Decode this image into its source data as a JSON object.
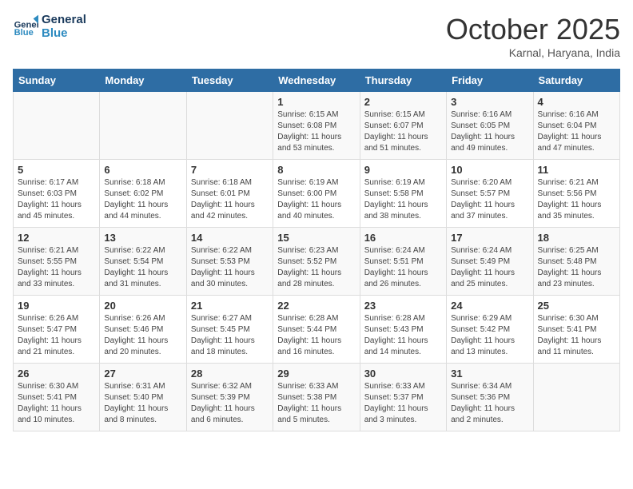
{
  "header": {
    "logo_line1": "General",
    "logo_line2": "Blue",
    "month": "October 2025",
    "location": "Karnal, Haryana, India"
  },
  "days_of_week": [
    "Sunday",
    "Monday",
    "Tuesday",
    "Wednesday",
    "Thursday",
    "Friday",
    "Saturday"
  ],
  "weeks": [
    [
      {
        "day": "",
        "info": ""
      },
      {
        "day": "",
        "info": ""
      },
      {
        "day": "",
        "info": ""
      },
      {
        "day": "1",
        "info": "Sunrise: 6:15 AM\nSunset: 6:08 PM\nDaylight: 11 hours\nand 53 minutes."
      },
      {
        "day": "2",
        "info": "Sunrise: 6:15 AM\nSunset: 6:07 PM\nDaylight: 11 hours\nand 51 minutes."
      },
      {
        "day": "3",
        "info": "Sunrise: 6:16 AM\nSunset: 6:05 PM\nDaylight: 11 hours\nand 49 minutes."
      },
      {
        "day": "4",
        "info": "Sunrise: 6:16 AM\nSunset: 6:04 PM\nDaylight: 11 hours\nand 47 minutes."
      }
    ],
    [
      {
        "day": "5",
        "info": "Sunrise: 6:17 AM\nSunset: 6:03 PM\nDaylight: 11 hours\nand 45 minutes."
      },
      {
        "day": "6",
        "info": "Sunrise: 6:18 AM\nSunset: 6:02 PM\nDaylight: 11 hours\nand 44 minutes."
      },
      {
        "day": "7",
        "info": "Sunrise: 6:18 AM\nSunset: 6:01 PM\nDaylight: 11 hours\nand 42 minutes."
      },
      {
        "day": "8",
        "info": "Sunrise: 6:19 AM\nSunset: 6:00 PM\nDaylight: 11 hours\nand 40 minutes."
      },
      {
        "day": "9",
        "info": "Sunrise: 6:19 AM\nSunset: 5:58 PM\nDaylight: 11 hours\nand 38 minutes."
      },
      {
        "day": "10",
        "info": "Sunrise: 6:20 AM\nSunset: 5:57 PM\nDaylight: 11 hours\nand 37 minutes."
      },
      {
        "day": "11",
        "info": "Sunrise: 6:21 AM\nSunset: 5:56 PM\nDaylight: 11 hours\nand 35 minutes."
      }
    ],
    [
      {
        "day": "12",
        "info": "Sunrise: 6:21 AM\nSunset: 5:55 PM\nDaylight: 11 hours\nand 33 minutes."
      },
      {
        "day": "13",
        "info": "Sunrise: 6:22 AM\nSunset: 5:54 PM\nDaylight: 11 hours\nand 31 minutes."
      },
      {
        "day": "14",
        "info": "Sunrise: 6:22 AM\nSunset: 5:53 PM\nDaylight: 11 hours\nand 30 minutes."
      },
      {
        "day": "15",
        "info": "Sunrise: 6:23 AM\nSunset: 5:52 PM\nDaylight: 11 hours\nand 28 minutes."
      },
      {
        "day": "16",
        "info": "Sunrise: 6:24 AM\nSunset: 5:51 PM\nDaylight: 11 hours\nand 26 minutes."
      },
      {
        "day": "17",
        "info": "Sunrise: 6:24 AM\nSunset: 5:49 PM\nDaylight: 11 hours\nand 25 minutes."
      },
      {
        "day": "18",
        "info": "Sunrise: 6:25 AM\nSunset: 5:48 PM\nDaylight: 11 hours\nand 23 minutes."
      }
    ],
    [
      {
        "day": "19",
        "info": "Sunrise: 6:26 AM\nSunset: 5:47 PM\nDaylight: 11 hours\nand 21 minutes."
      },
      {
        "day": "20",
        "info": "Sunrise: 6:26 AM\nSunset: 5:46 PM\nDaylight: 11 hours\nand 20 minutes."
      },
      {
        "day": "21",
        "info": "Sunrise: 6:27 AM\nSunset: 5:45 PM\nDaylight: 11 hours\nand 18 minutes."
      },
      {
        "day": "22",
        "info": "Sunrise: 6:28 AM\nSunset: 5:44 PM\nDaylight: 11 hours\nand 16 minutes."
      },
      {
        "day": "23",
        "info": "Sunrise: 6:28 AM\nSunset: 5:43 PM\nDaylight: 11 hours\nand 14 minutes."
      },
      {
        "day": "24",
        "info": "Sunrise: 6:29 AM\nSunset: 5:42 PM\nDaylight: 11 hours\nand 13 minutes."
      },
      {
        "day": "25",
        "info": "Sunrise: 6:30 AM\nSunset: 5:41 PM\nDaylight: 11 hours\nand 11 minutes."
      }
    ],
    [
      {
        "day": "26",
        "info": "Sunrise: 6:30 AM\nSunset: 5:41 PM\nDaylight: 11 hours\nand 10 minutes."
      },
      {
        "day": "27",
        "info": "Sunrise: 6:31 AM\nSunset: 5:40 PM\nDaylight: 11 hours\nand 8 minutes."
      },
      {
        "day": "28",
        "info": "Sunrise: 6:32 AM\nSunset: 5:39 PM\nDaylight: 11 hours\nand 6 minutes."
      },
      {
        "day": "29",
        "info": "Sunrise: 6:33 AM\nSunset: 5:38 PM\nDaylight: 11 hours\nand 5 minutes."
      },
      {
        "day": "30",
        "info": "Sunrise: 6:33 AM\nSunset: 5:37 PM\nDaylight: 11 hours\nand 3 minutes."
      },
      {
        "day": "31",
        "info": "Sunrise: 6:34 AM\nSunset: 5:36 PM\nDaylight: 11 hours\nand 2 minutes."
      },
      {
        "day": "",
        "info": ""
      }
    ]
  ]
}
